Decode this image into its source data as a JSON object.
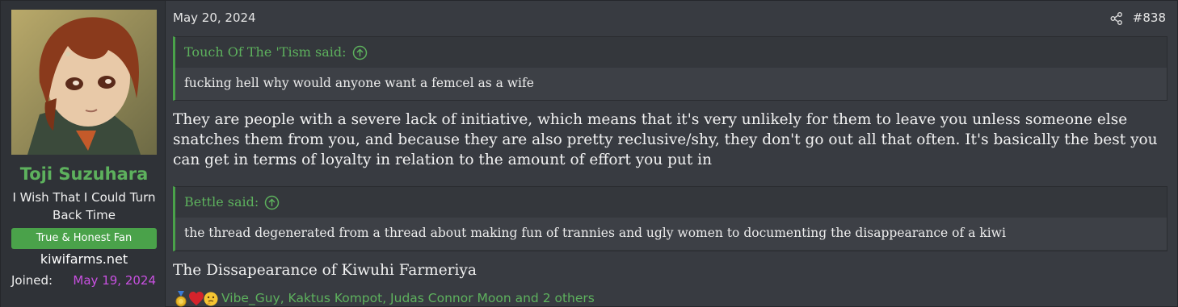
{
  "user": {
    "name": "Toji Suzuhara",
    "title": "I Wish That I Could Turn Back Time",
    "banner": "True & Honest Fan",
    "site": "kiwifarms.net",
    "joined_label": "Joined:",
    "joined_date": "May 19, 2024"
  },
  "post": {
    "date": "May 20, 2024",
    "number": "#838",
    "quote1": {
      "author": "Touch Of The 'Tism said:",
      "text": "fucking hell why would anyone want a femcel as a wife"
    },
    "body1": "They are people with a severe lack of initiative, which means that it's very unlikely for them to leave you unless someone else snatches them from you, and because they are also pretty reclusive/shy, they don't go out all that often. It's basically the best you can get in terms of loyalty in relation to the amount of effort you put in",
    "quote2": {
      "author": "Bettle said:",
      "text": "the thread degenerated from a thread about making fun of trannies and ugly women to documenting the disappearance of a kiwi"
    },
    "body2": "The Dissapearance of Kiwuhi Farmeriya",
    "reactions": {
      "icons": [
        "medal-icon",
        "heart-icon",
        "thinking-face-icon"
      ],
      "names": "Vibe_Guy, Kaktus Kompot, Judas Connor Moon and 2 others"
    }
  },
  "colors": {
    "accent_green": "#5db15d",
    "joined_purple": "#c850e0",
    "post_bg": "#383b41"
  }
}
